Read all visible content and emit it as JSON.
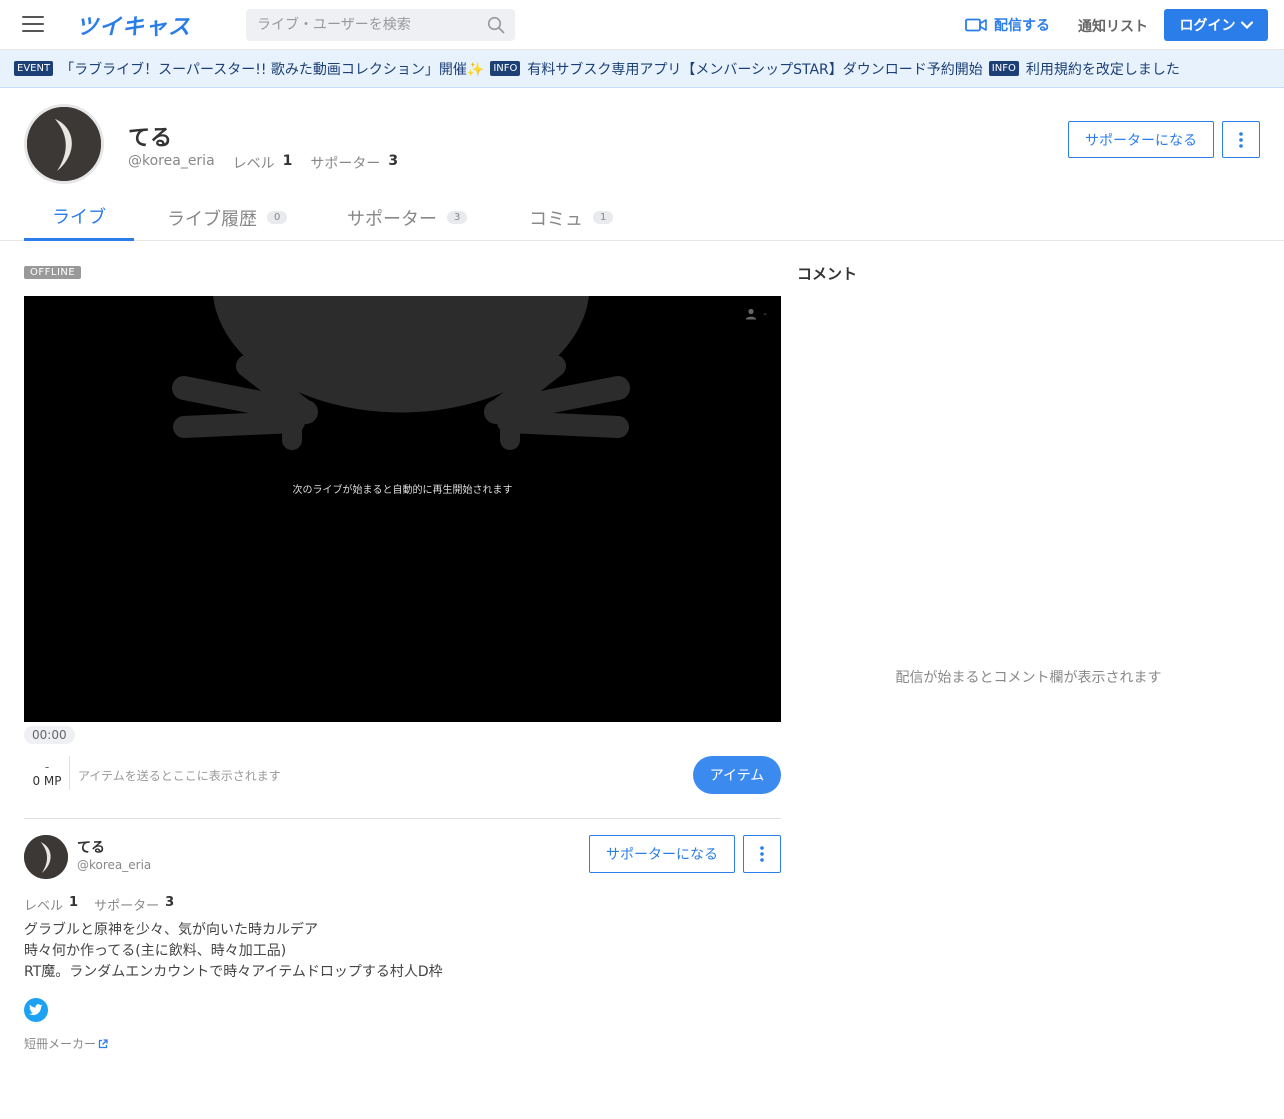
{
  "header": {
    "logo": "ツイキャス",
    "search_placeholder": "ライブ・ユーザーを検索",
    "broadcast_label": "配信する",
    "notification_label": "通知リスト",
    "login_label": "ログイン",
    "accent_color": "#2b7de9"
  },
  "ticker": [
    {
      "badge": "EVENT",
      "text": "「ラブライブ！スーパースター!! 歌みた動画コレクション」開催✨"
    },
    {
      "badge": "INFO",
      "text": "有料サブスク専用アプリ【メンバーシップSTAR】ダウンロード予約開始"
    },
    {
      "badge": "INFO",
      "text": "利用規約を改定しました"
    }
  ],
  "profile": {
    "name": "てる",
    "handle": "@korea_eria",
    "level_label": "レベル",
    "level": "1",
    "supporters_label": "サポーター",
    "supporters": "3",
    "support_button": "サポーターになる"
  },
  "tabs": [
    {
      "label": "ライブ",
      "count": ""
    },
    {
      "label": "ライブ履歴",
      "count": "0"
    },
    {
      "label": "サポーター",
      "count": "3"
    },
    {
      "label": "コミュ",
      "count": "1"
    }
  ],
  "player": {
    "status": "OFFLINE",
    "message": "次のライブが始まると自動的に再生開始されます",
    "viewers": "-",
    "time": "00:00"
  },
  "items": {
    "mp_dash": "-",
    "mp_value": "0 MP",
    "placeholder": "アイテムを送るとここに表示されます",
    "button": "アイテム"
  },
  "user_card": {
    "name": "てる",
    "handle": "@korea_eria",
    "support_button": "サポーターになる",
    "level_label": "レベル",
    "level": "1",
    "supporters_label": "サポーター",
    "supporters": "3",
    "bio": [
      "グラブルと原神を少々、気が向いた時カルデア",
      "時々何か作ってる(主に飲料、時々加工品)",
      "RT魔。ランダムエンカウントで時々アイテムドロップする村人D枠"
    ],
    "tanzaku_link": "短冊メーカー"
  },
  "comments": {
    "title": "コメント",
    "empty_message": "配信が始まるとコメント欄が表示されます"
  }
}
